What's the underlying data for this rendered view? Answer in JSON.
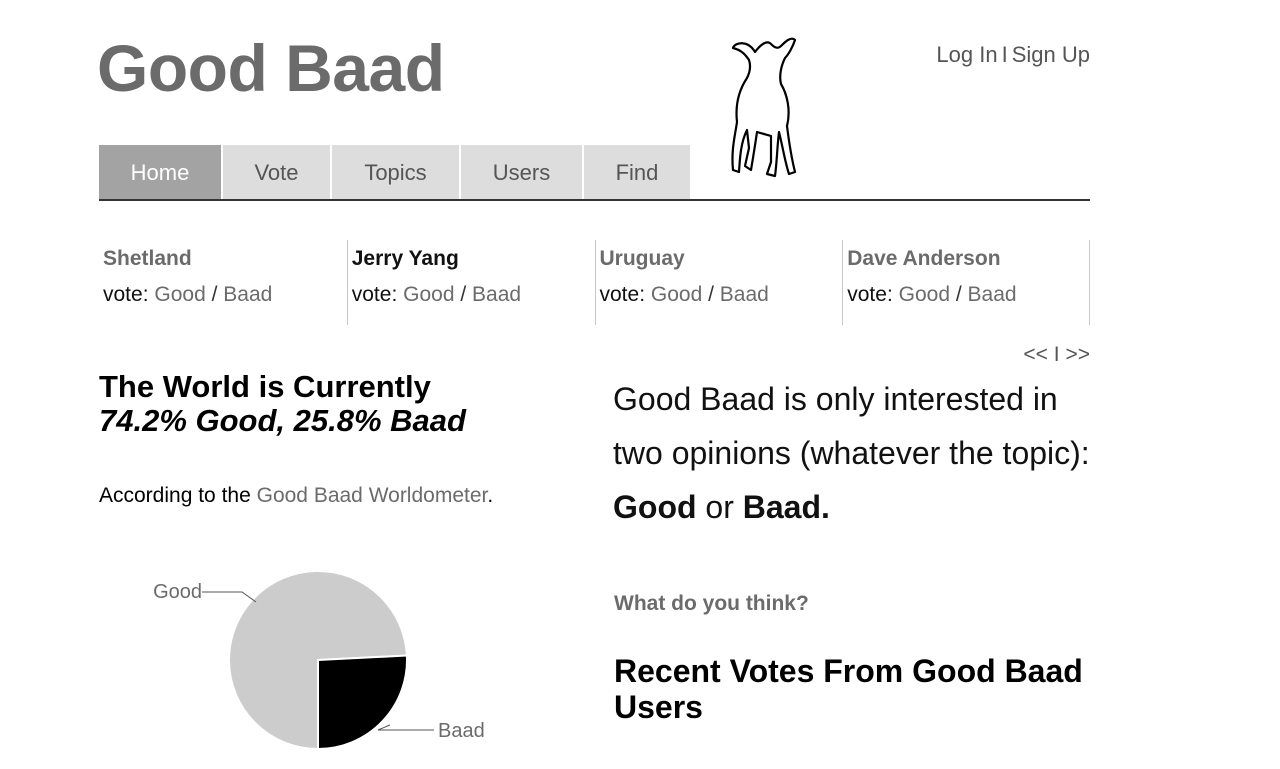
{
  "site": {
    "title": "Good Baad"
  },
  "auth": {
    "login": "Log In",
    "separator": "I",
    "signup": "Sign Up"
  },
  "nav": {
    "tabs": [
      {
        "label": "Home"
      },
      {
        "label": "Vote"
      },
      {
        "label": "Topics"
      },
      {
        "label": "Users"
      },
      {
        "label": "Find"
      }
    ]
  },
  "topics": [
    {
      "name": "Shetland",
      "vote_prefix": "vote:",
      "good": "Good",
      "slash": "/",
      "baad": "Baad"
    },
    {
      "name": "Jerry Yang",
      "vote_prefix": "vote:",
      "good": "Good",
      "slash": "/",
      "baad": "Baad"
    },
    {
      "name": "Uruguay",
      "vote_prefix": "vote:",
      "good": "Good",
      "slash": "/",
      "baad": "Baad"
    },
    {
      "name": "Dave Anderson",
      "vote_prefix": "vote:",
      "good": "Good",
      "slash": "/",
      "baad": "Baad"
    }
  ],
  "pager": {
    "prev": "<<",
    "separator": "I",
    "next": ">>"
  },
  "world": {
    "heading": "The World is Currently",
    "stats": "74.2% Good, 25.8% Baad",
    "according_prefix": "According to the",
    "according_link": "Good Baad Worldometer",
    "according_suffix": "."
  },
  "chart_data": {
    "type": "pie",
    "labels": [
      "Good",
      "Baad"
    ],
    "values": [
      74.2,
      25.8
    ],
    "colors": [
      "#cccccc",
      "#000000"
    ]
  },
  "intro": {
    "text": "Good Baad is only interested in two opinions (whatever the topic):",
    "good": "Good",
    "or": "or",
    "baad": "Baad."
  },
  "question": "What do you think?",
  "recent_heading": "Recent Votes From Good Baad Users"
}
